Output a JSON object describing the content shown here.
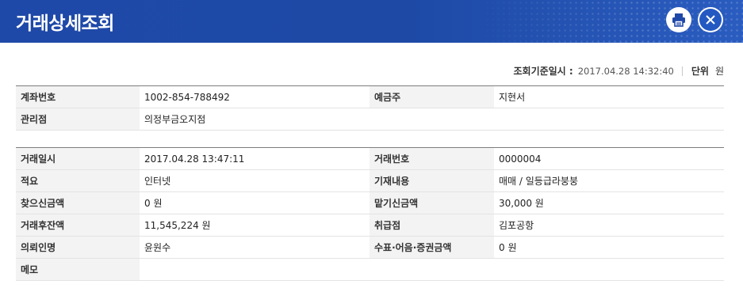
{
  "header": {
    "title": "거래상세조회",
    "print_icon": "printer-icon",
    "close_icon": "close-icon",
    "accent": "#1f49a8"
  },
  "meta": {
    "query_label": "조회기준일시 :",
    "query_value": "2017.04.28 14:32:40",
    "unit_label": "단위",
    "unit_value": "원"
  },
  "account": {
    "account_no_label": "계좌번호",
    "account_no": "1002-854-788492",
    "holder_label": "예금주",
    "holder": "지현서",
    "branch_label": "관리점",
    "branch": "의정부금오지점"
  },
  "transaction": {
    "datetime_label": "거래일시",
    "datetime": "2017.04.28 13:47:11",
    "tx_no_label": "거래번호",
    "tx_no": "0000004",
    "summary_label": "적요",
    "summary": "인터넷",
    "memo_content_label": "기재내용",
    "memo_content": "매매 / 일등급라붕붕",
    "withdraw_label": "찾으신금액",
    "withdraw": "0 원",
    "deposit_label": "맡기신금액",
    "deposit": "30,000 원",
    "balance_label": "거래후잔액",
    "balance": "11,545,224 원",
    "handler_label": "취급점",
    "handler": "김포공항",
    "requester_label": "의뢰인명",
    "requester": "윤원수",
    "check_label": "수표·어음·증권금액",
    "check": "0 원",
    "memo_label": "메모",
    "memo": ""
  }
}
